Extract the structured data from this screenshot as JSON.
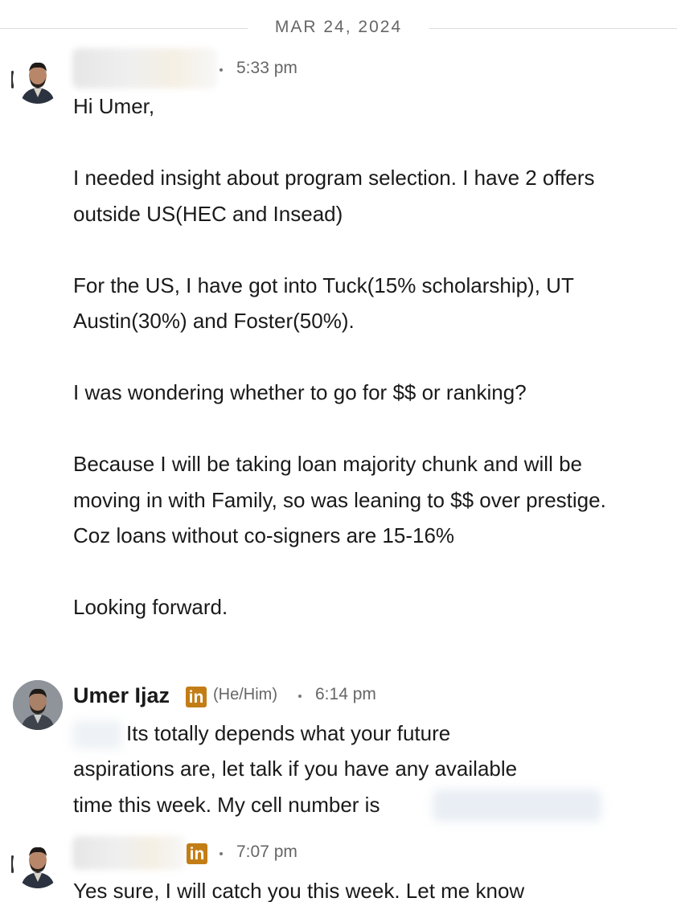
{
  "date_divider": "MAR 24, 2024",
  "messages": [
    {
      "time": "5:33 pm",
      "paragraphs": [
        "Hi Umer,",
        "I needed insight about program selection. I have 2 offers outside US(HEC and Insead)",
        "For the US, I have got into Tuck(15% scholarship), UT Austin(30%) and Foster(50%).",
        "I was wondering whether to go for $$ or ranking?",
        "Because I will be taking loan majority chunk and will be moving in with Family, so was leaning to $$ over prestige. Coz loans without co-signers are 15-16%",
        "Looking forward."
      ]
    },
    {
      "sender": "Umer Ijaz",
      "linkedin_badge": "in",
      "pronouns": "(He/Him)",
      "time": "6:14 pm",
      "lines": [
        "Its totally depends what your future",
        "aspirations are, let talk if you have any available",
        "time this week. My cell number is"
      ]
    },
    {
      "linkedin_badge": "in",
      "time": "7:07 pm",
      "lines": [
        "Yes sure, I will catch you this week. Let me know"
      ]
    }
  ]
}
